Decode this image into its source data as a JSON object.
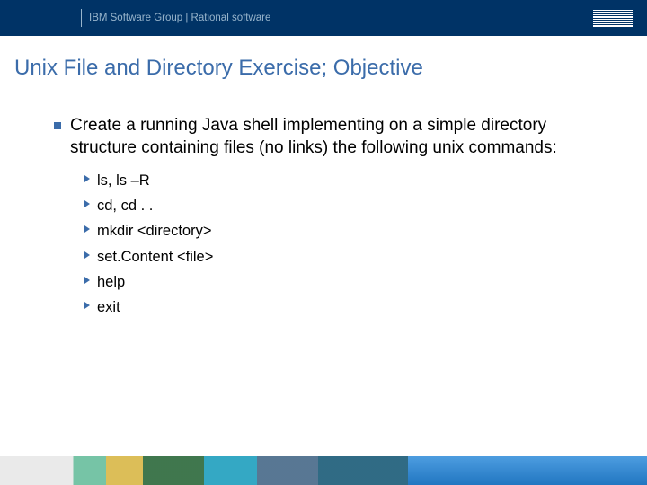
{
  "header": {
    "text": "IBM Software Group | Rational software",
    "logo_name": "IBM"
  },
  "title": "Unix File and Directory Exercise; Objective",
  "main_bullet": "Create a running Java shell implementing on a simple directory structure containing files (no links) the following unix commands:",
  "sub_items": [
    "ls, ls –R",
    "cd, cd . .",
    "mkdir <directory>",
    "set.Content <file>",
    "help",
    "exit"
  ]
}
